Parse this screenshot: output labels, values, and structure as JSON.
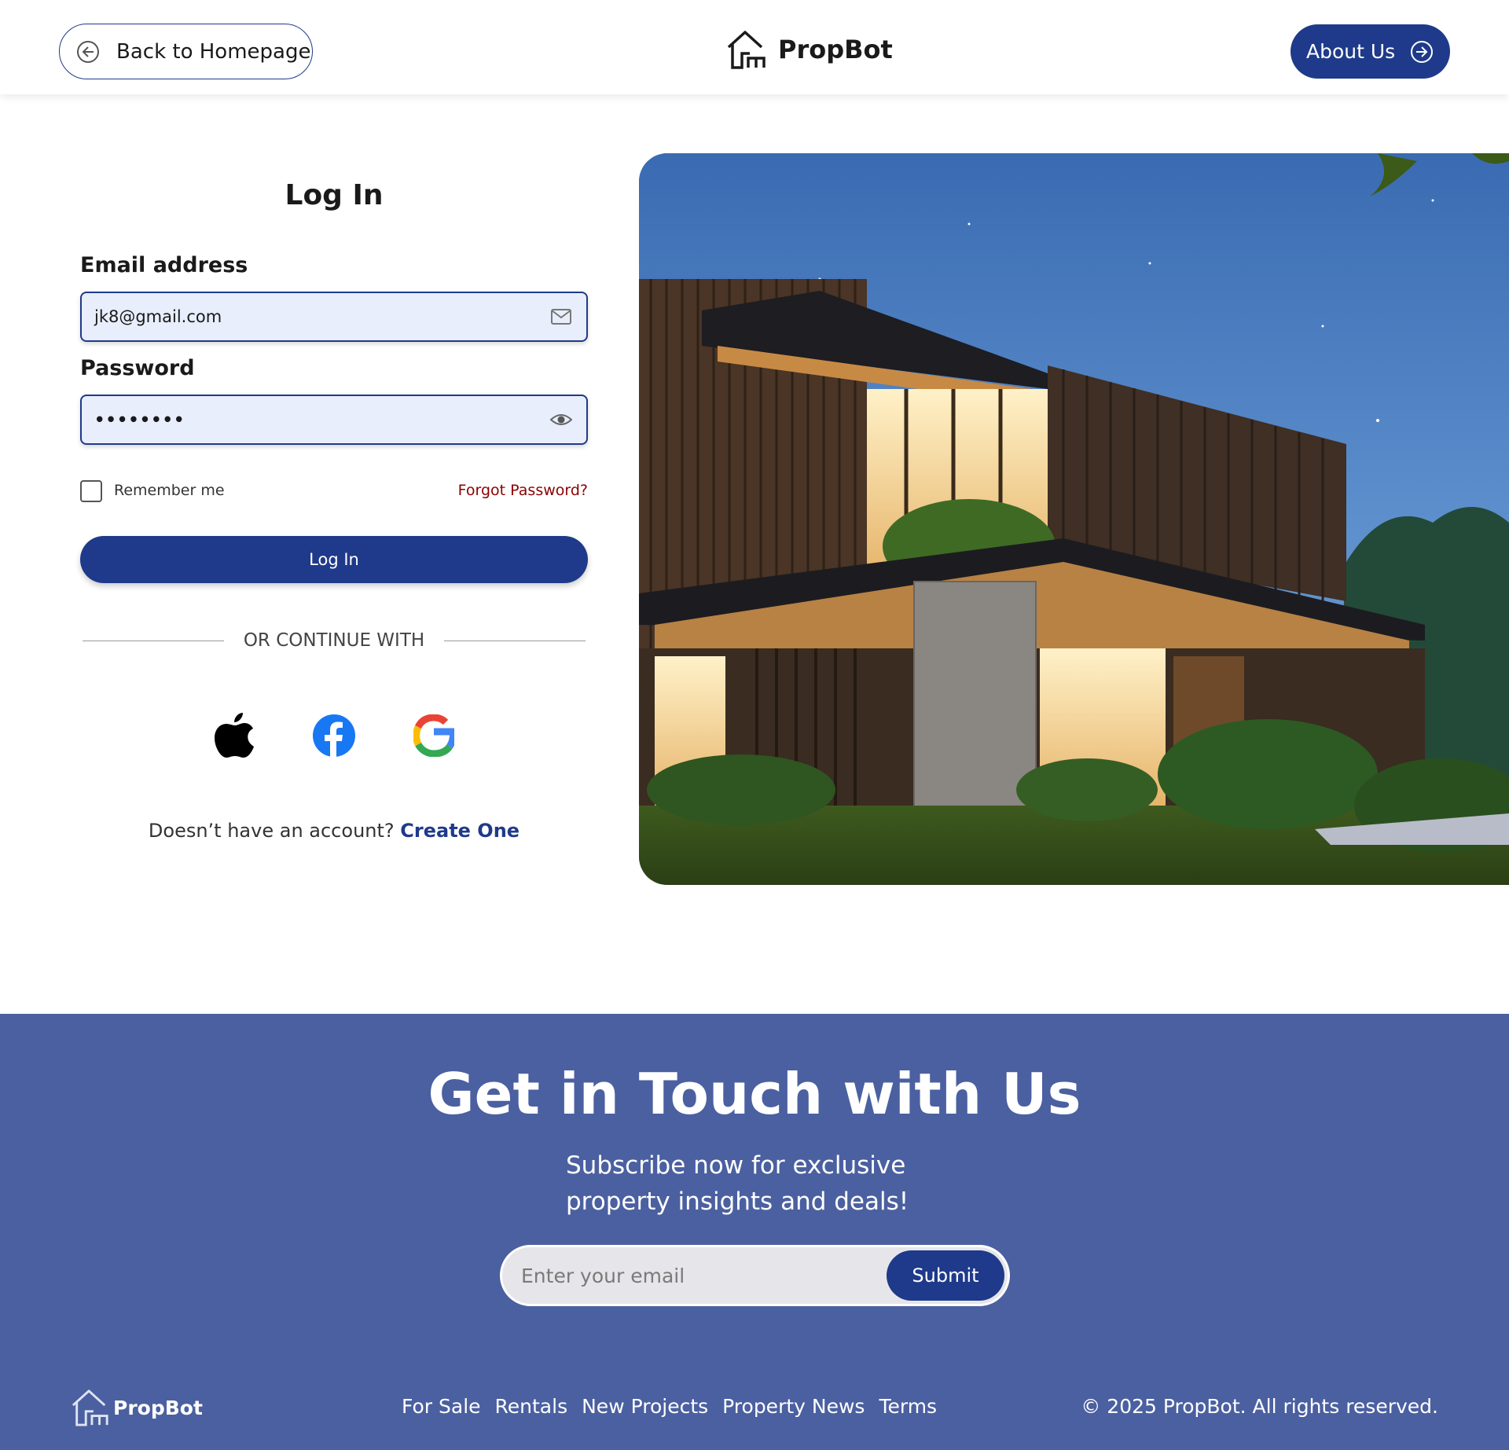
{
  "header": {
    "back_label": "Back to Homepage",
    "brand": "PropBot",
    "about_label": "About Us"
  },
  "login": {
    "title": "Log In",
    "email_label": "Email address",
    "email_value": "jk8@gmail.com",
    "password_label": "Password",
    "password_value": "••••••••",
    "remember_label": "Remember me",
    "forgot_label": "Forgot Password?",
    "submit_label": "Log In",
    "or_label": "OR CONTINUE WITH",
    "signup_prompt": "Doesn’t have an account?",
    "signup_link": "Create One"
  },
  "footer": {
    "title": "Get in Touch with Us",
    "subtitle_line1": "Subscribe now for exclusive",
    "subtitle_line2": "property insights and deals!",
    "email_placeholder": "Enter your email",
    "submit_label": "Submit",
    "brand": "PropBot",
    "links": [
      "For Sale",
      "Rentals",
      "New Projects",
      "Property News",
      "Terms"
    ],
    "copyright": "© 2025 PropBot. All rights reserved."
  },
  "colors": {
    "primary": "#1f3a8a",
    "footer_bg": "#4b60a0",
    "input_bg": "#e8eefc",
    "forgot": "#8b0000"
  }
}
